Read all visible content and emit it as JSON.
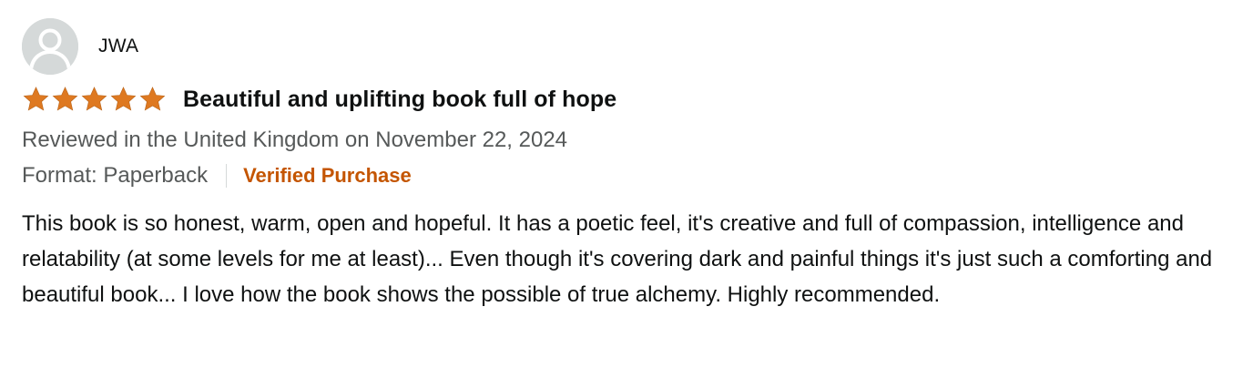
{
  "reviewer": {
    "name": "JWA",
    "avatar_icon": "user-silhouette-icon"
  },
  "rating": {
    "value": 5,
    "max": 5,
    "star_color": "#de7921",
    "icon": "star-icon"
  },
  "review": {
    "title": "Beautiful and uplifting book full of hope",
    "date_text": "Reviewed in the United Kingdom on November 22, 2024",
    "format_text": "Format: Paperback",
    "verified_label": "Verified Purchase",
    "body": "This book is so honest, warm, open and hopeful. It has a poetic feel, it's creative and full of compassion, intelligence and relatability (at some levels for me at least)... Even though it's covering dark and painful things it's just such a comforting and beautiful book... I love how the book shows the possible of true alchemy. Highly recommended."
  },
  "colors": {
    "verified": "#c45500",
    "secondary_text": "#565959",
    "avatar_bg": "#d5d9d9"
  }
}
